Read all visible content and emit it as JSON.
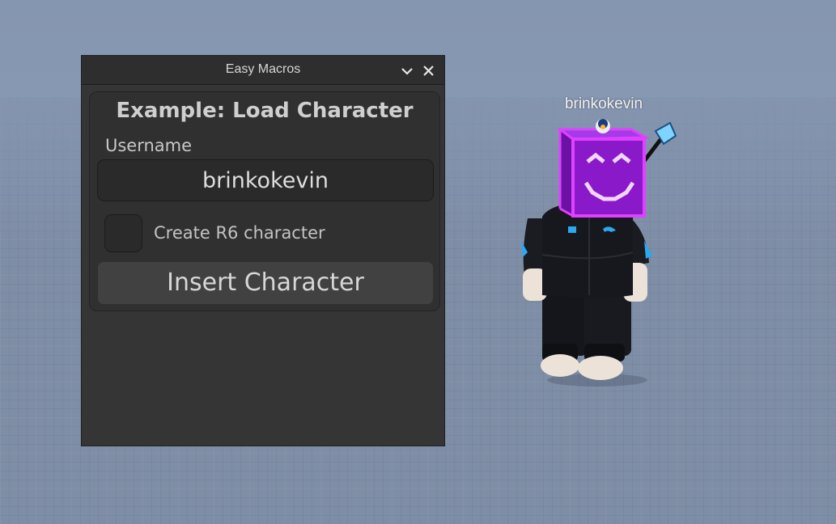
{
  "window": {
    "title": "Easy Macros"
  },
  "panel": {
    "example_title": "Example: Load Character",
    "username_label": "Username",
    "username_value": "brinkokevin",
    "checkbox_label": "Create R6 character",
    "checkbox_checked": false,
    "insert_button_label": "Insert Character"
  },
  "character": {
    "nametag": "brinkokevin"
  },
  "colors": {
    "window_bg": "#353535",
    "panel_bg": "#303030",
    "button_bg": "#414141",
    "head_purple": "#8a19c9",
    "head_outline": "#e040ff",
    "jacket": "#15171c",
    "accent_blue": "#2aa8f0"
  },
  "icons": {
    "collapse": "chevron-down-icon",
    "close": "close-icon"
  }
}
